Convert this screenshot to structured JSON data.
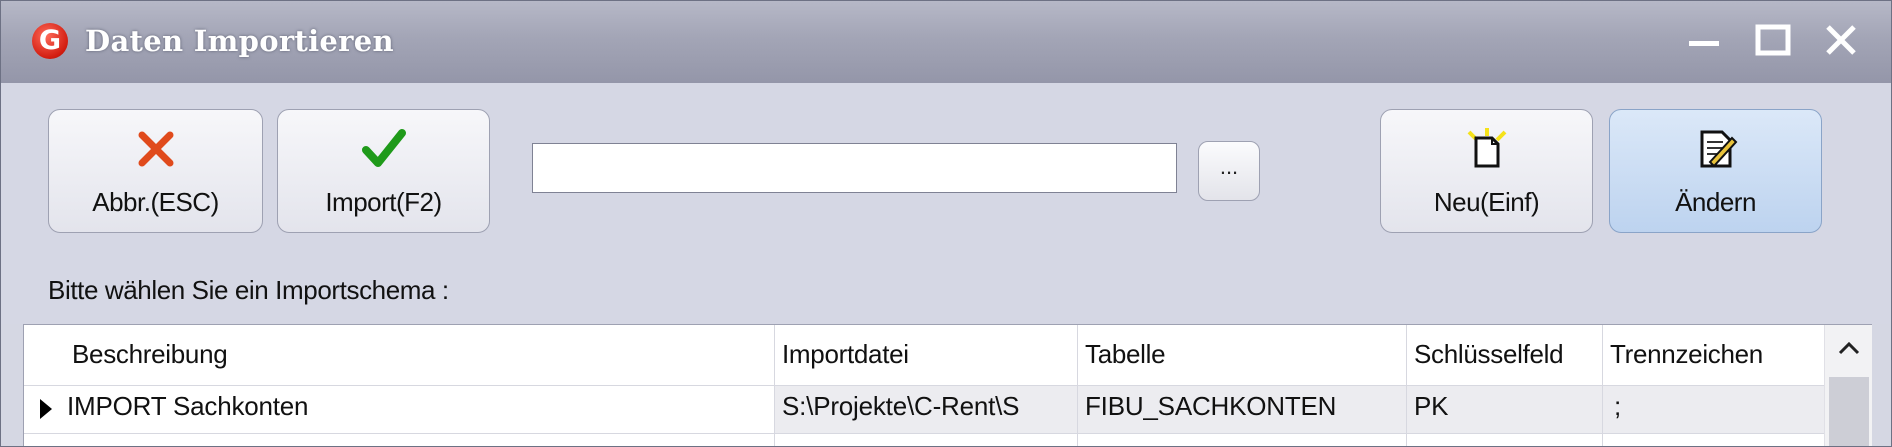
{
  "window": {
    "title": "Daten Importieren",
    "app_icon_letter": "G",
    "controls": [
      "minimize-icon",
      "maximize-icon",
      "close-icon"
    ]
  },
  "toolbar": {
    "cancel_label": "Abbr.(ESC)",
    "import_label": "Import(F2)",
    "file_path_value": "",
    "browse_label": "...",
    "new_label": "Neu(Einf)",
    "edit_label": "Ändern"
  },
  "prompt": "Bitte wählen Sie ein Importschema :",
  "grid": {
    "columns": [
      "Beschreibung",
      "Importdatei",
      "Tabelle",
      "Schlüsselfeld",
      "Trennzeichen"
    ],
    "rows": [
      {
        "beschreibung": "IMPORT Sachkonten",
        "importdatei": "S:\\Projekte\\C-Rent\\S",
        "tabelle": "FIBU_SACHKONTEN",
        "schluesselfeld": "PK",
        "trennzeichen": ";"
      }
    ]
  },
  "colors": {
    "titlebar": "#a3a5b6",
    "active_button": "#bdd3ef",
    "cancel_icon": "#e04a1c",
    "import_icon": "#1f9a1a"
  }
}
